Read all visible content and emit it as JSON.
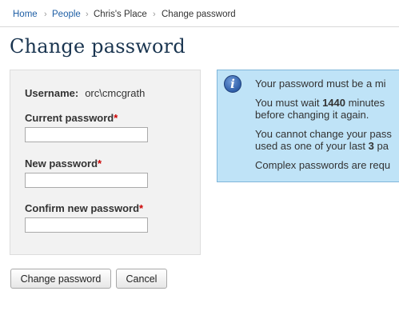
{
  "breadcrumb": {
    "items": [
      {
        "label": "Home"
      },
      {
        "label": "People"
      },
      {
        "label": "Chris's Place"
      },
      {
        "label": "Change password"
      }
    ]
  },
  "page": {
    "title": "Change password"
  },
  "form": {
    "username_label": "Username:",
    "username_value": "orc\\cmcgrath",
    "current_password_label": "Current password",
    "new_password_label": "New password",
    "confirm_password_label": "Confirm new password",
    "required_marker": "*",
    "current_password_value": "",
    "new_password_value": "",
    "confirm_password_value": ""
  },
  "info": {
    "icon": "info-icon",
    "line1": "Your password must be a mi",
    "line2_prefix": "You must wait ",
    "line2_number": "1440",
    "line2_suffix": " minutes",
    "line3": "before changing it again.",
    "line4": "You cannot change your pass",
    "line5_prefix": "used as one of your last ",
    "line5_number": "3",
    "line5_suffix": " pa",
    "line6": "Complex passwords are requ"
  },
  "buttons": {
    "change_password": "Change password",
    "cancel": "Cancel"
  },
  "colors": {
    "link": "#1f5fa5",
    "title": "#1a3550",
    "required": "#cc0000",
    "info_background": "#bfe3f7",
    "info_border": "#7fb6da"
  }
}
